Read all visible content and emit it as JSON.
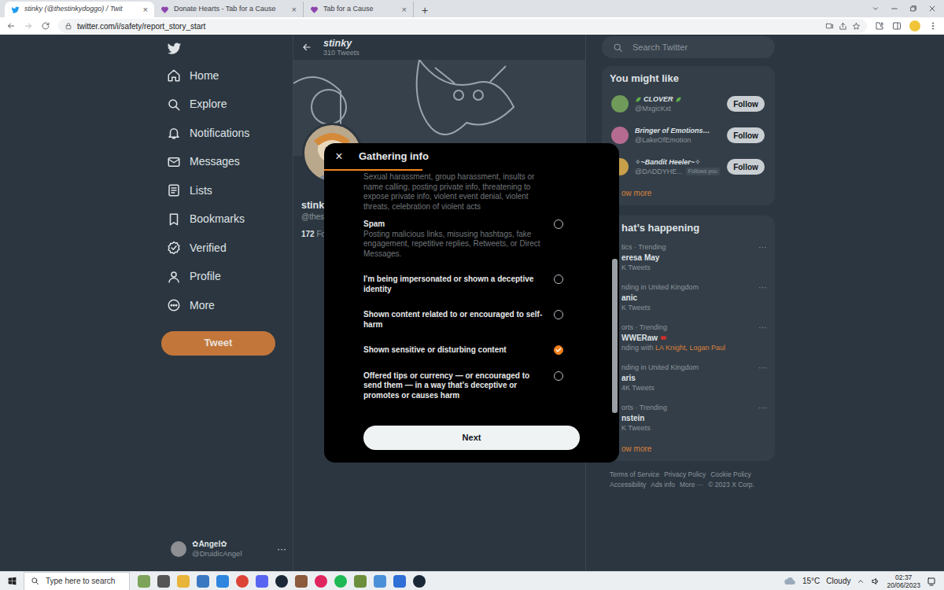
{
  "browser": {
    "tabs": [
      {
        "label": "stinky (@thestinkydoggo) / Twit",
        "close": "×",
        "selected": true
      },
      {
        "label": "Donate Hearts - Tab for a Cause",
        "close": "×",
        "selected": false
      },
      {
        "label": "Tab for a Cause",
        "close": "×",
        "selected": false
      }
    ],
    "new_tab": "+",
    "address": "twitter.com/i/safety/report_story_start"
  },
  "sidebar": {
    "items": [
      {
        "label": "Home"
      },
      {
        "label": "Explore"
      },
      {
        "label": "Notifications"
      },
      {
        "label": "Messages"
      },
      {
        "label": "Lists"
      },
      {
        "label": "Bookmarks"
      },
      {
        "label": "Verified"
      },
      {
        "label": "Profile"
      },
      {
        "label": "More"
      }
    ],
    "tweet_button": "Tweet",
    "account": {
      "name": "✿Angel✿",
      "handle": "@DruidicAngel",
      "menu": "···"
    }
  },
  "profile": {
    "name": "stinky",
    "tweet_count": "310 Tweets",
    "display_name": "stink",
    "handle": "@thest",
    "following_count": "172",
    "following_label": "Fo"
  },
  "right": {
    "search": {
      "placeholder": "Search Twitter"
    },
    "you_might_like": {
      "title": "You might like",
      "users": [
        {
          "name": "CLOVER",
          "handle": "@MxgicKxt",
          "button": "Follow"
        },
        {
          "name": "Bringer of Emotions…",
          "handle": "@LakeOfEmotion",
          "button": "Follow"
        },
        {
          "name": "✧~Bandit Heeler~✧",
          "handle": "@DADDYHE...",
          "badge": "Follows you",
          "button": "Follow"
        }
      ],
      "show_more": "ow more"
    },
    "trending": {
      "title": "hat’s happening",
      "items": [
        {
          "meta": "tics · Trending",
          "topic": "eresa May",
          "count": "K Tweets",
          "menu": "···"
        },
        {
          "meta": "nding in United Kingdom",
          "topic": "anic",
          "count": "K Tweets",
          "menu": "···"
        },
        {
          "meta": "orts · Trending",
          "topic": "WWERaw",
          "with_prefix": "nding with",
          "with_links": "LA Knight, Logan Paul",
          "menu": "···"
        },
        {
          "meta": "nding in United Kingdom",
          "topic": "aris",
          "count": "4K Tweets",
          "menu": "···"
        },
        {
          "meta": "orts · Trending",
          "topic": "nstein",
          "count": "K Tweets",
          "menu": "···"
        }
      ],
      "show_more": "ow more"
    },
    "footer": {
      "links": [
        "Terms of Service",
        "Privacy Policy",
        "Cookie Policy",
        "Accessibility",
        "Ads info",
        "More ···"
      ],
      "copyright": "© 2023 X Corp."
    }
  },
  "modal": {
    "title": "Gathering info",
    "close": "×",
    "progress": {
      "level": 0.333
    },
    "lead_description": "Sexual harassment, group harassment, insults or name calling, posting private info, threatening to expose private info, violent event denial, violent threats, celebration of violent acts",
    "options": [
      {
        "title": "Spam",
        "description": "Posting malicious links, misusing hashtags, fake engagement, repetitive replies, Retweets, or Direct Messages.",
        "selected": false
      },
      {
        "title": "I'm being impersonated or shown a deceptive identity",
        "selected": false
      },
      {
        "title": "Shown content related to or encouraged to self-harm",
        "selected": false
      },
      {
        "title": "Shown sensitive or disturbing content",
        "selected": true
      },
      {
        "title": "Offered tips or currency — or encouraged to send them — in a way that’s deceptive or promotes or causes harm",
        "selected": false
      }
    ],
    "scrollbar": {
      "level": 0.64
    },
    "next_button": "Next"
  },
  "taskbar": {
    "search_placeholder": "Type here to search",
    "temperature": "15°C",
    "weather": "Cloudy",
    "time": "02:37",
    "date": "20/06/2023"
  }
}
